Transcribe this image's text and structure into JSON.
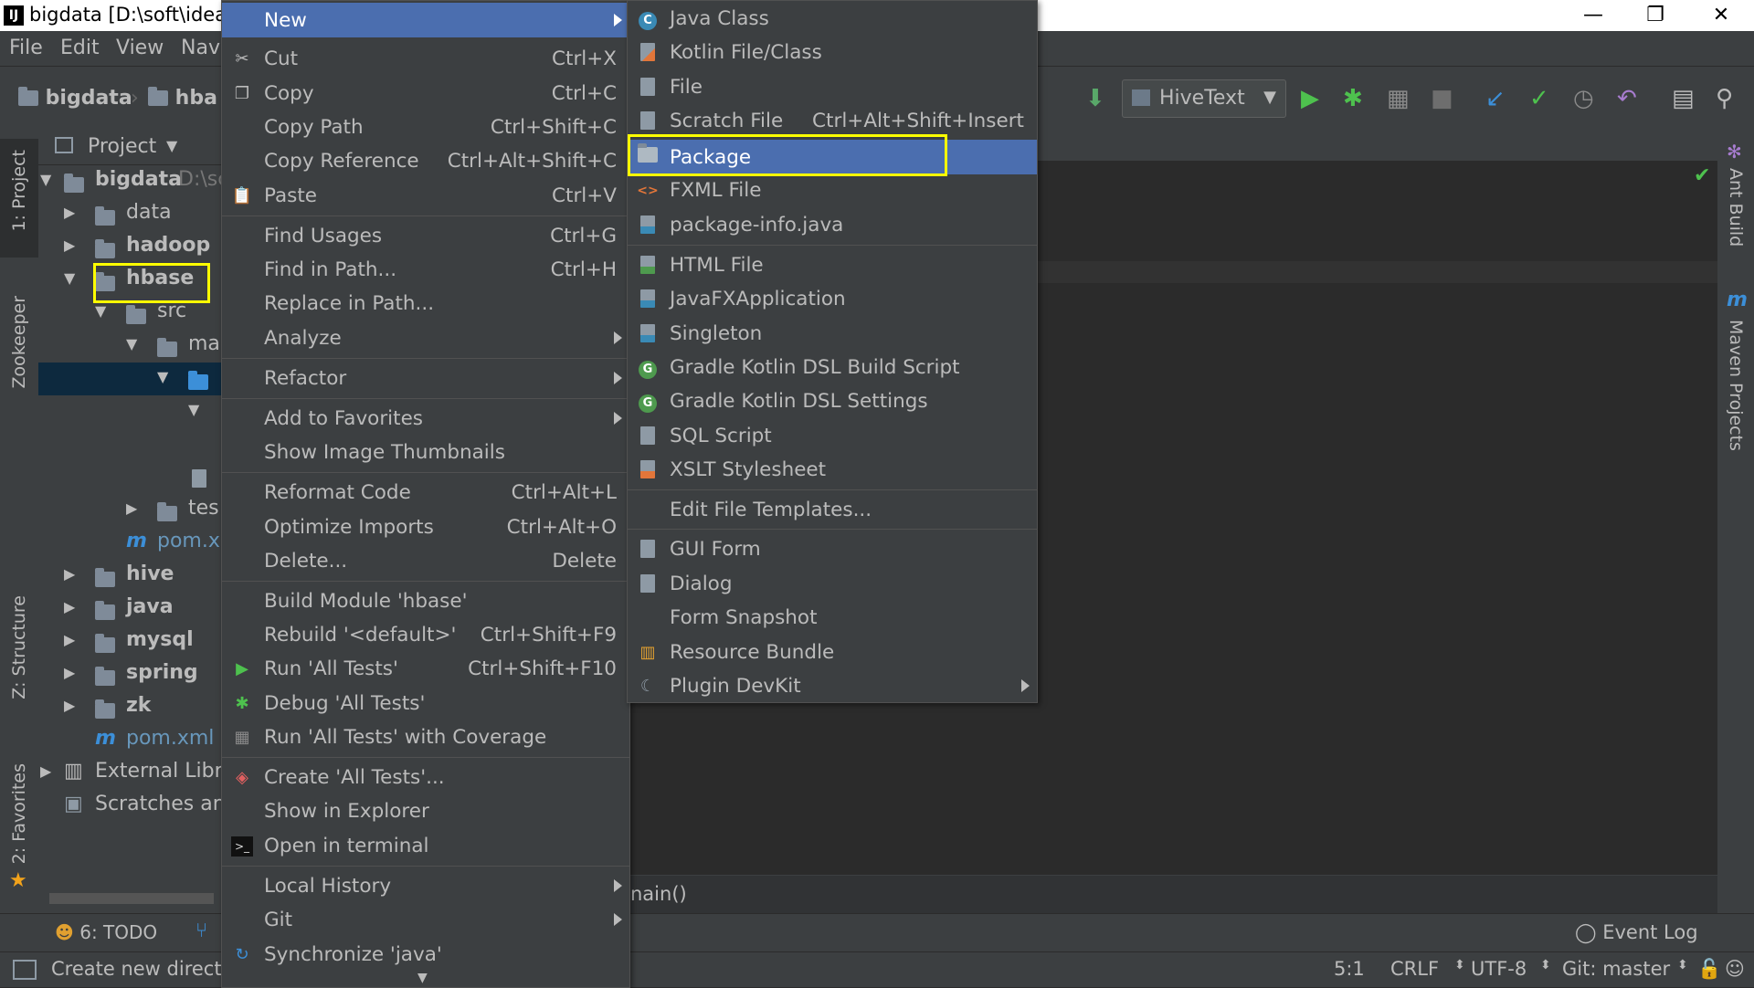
{
  "window": {
    "title": "bigdata [D:\\soft\\ideafiles",
    "ij_label": "IJ",
    "min_glyph": "—",
    "max_glyph": "❐",
    "close_glyph": "✕"
  },
  "menubar": [
    {
      "label": "File"
    },
    {
      "label": "Edit"
    },
    {
      "label": "View"
    },
    {
      "label": "Nav"
    }
  ],
  "breadcrumb": [
    {
      "label": "bigdata"
    },
    {
      "label": "hba"
    }
  ],
  "toolbar": {
    "run_config": "HiveText"
  },
  "left_stripe": {
    "project": "1: Project",
    "zookeeper": "Zookeeper",
    "structure": "Z: Structure",
    "favorites": "2: Favorites"
  },
  "project_panel": {
    "header": "Project",
    "tree": [
      {
        "label": "bigdata",
        "suffix": "D:\\sc",
        "bold": true,
        "expanded": true
      },
      {
        "label": "data"
      },
      {
        "label": "hadoop",
        "bold": true
      },
      {
        "label": "hbase",
        "bold": true,
        "expanded": true
      },
      {
        "label": "src",
        "expanded": true
      },
      {
        "label": "ma",
        "expanded": true
      },
      {
        "label": ""
      },
      {
        "label": ""
      },
      {
        "label": ""
      },
      {
        "label": "tes"
      },
      {
        "label": "pom.xı"
      },
      {
        "label": "hive",
        "bold": true
      },
      {
        "label": "java",
        "bold": true
      },
      {
        "label": "mysql",
        "bold": true
      },
      {
        "label": "spring",
        "bold": true
      },
      {
        "label": "zk",
        "bold": true
      },
      {
        "label": "pom.xml"
      },
      {
        "label": "External Libra"
      },
      {
        "label": "Scratches and"
      }
    ]
  },
  "editor": {
    "breadcrumb_text": "nain()"
  },
  "right_stripe": {
    "ant": "Ant Build",
    "maven": "Maven Projects"
  },
  "bottom_tools": {
    "todo": "6: TODO",
    "event_log": "Event Log"
  },
  "statusbar": {
    "message": "Create new directo",
    "position": "5:1",
    "line_sep": "CRLF",
    "encoding": "UTF-8",
    "vcs": "Git: master"
  },
  "context_menu": {
    "items": [
      {
        "label": "New",
        "submenu": true,
        "selected": true
      },
      {
        "label": "Cut",
        "shortcut": "Ctrl+X",
        "icon": "scissors-icon"
      },
      {
        "label": "Copy",
        "shortcut": "Ctrl+C",
        "icon": "copy-icon"
      },
      {
        "label": "Copy Path",
        "shortcut": "Ctrl+Shift+C"
      },
      {
        "label": "Copy Reference",
        "shortcut": "Ctrl+Alt+Shift+C"
      },
      {
        "label": "Paste",
        "shortcut": "Ctrl+V",
        "icon": "paste-icon"
      },
      {
        "label": "Find Usages",
        "shortcut": "Ctrl+G"
      },
      {
        "label": "Find in Path...",
        "shortcut": "Ctrl+H"
      },
      {
        "label": "Replace in Path..."
      },
      {
        "label": "Analyze",
        "submenu": true
      },
      {
        "label": "Refactor",
        "submenu": true
      },
      {
        "label": "Add to Favorites",
        "submenu": true
      },
      {
        "label": "Show Image Thumbnails"
      },
      {
        "label": "Reformat Code",
        "shortcut": "Ctrl+Alt+L"
      },
      {
        "label": "Optimize Imports",
        "shortcut": "Ctrl+Alt+O"
      },
      {
        "label": "Delete...",
        "shortcut": "Delete"
      },
      {
        "label": "Build Module 'hbase'"
      },
      {
        "label": "Rebuild '<default>'",
        "shortcut": "Ctrl+Shift+F9"
      },
      {
        "label": "Run 'All Tests'",
        "shortcut": "Ctrl+Shift+F10",
        "icon": "run-icon"
      },
      {
        "label": "Debug 'All Tests'",
        "icon": "debug-icon"
      },
      {
        "label": "Run 'All Tests' with Coverage",
        "icon": "coverage-icon"
      },
      {
        "label": "Create 'All Tests'...",
        "icon": "create-test-icon"
      },
      {
        "label": "Show in Explorer"
      },
      {
        "label": "Open in terminal",
        "icon": "terminal-icon"
      },
      {
        "label": "Local History",
        "submenu": true
      },
      {
        "label": "Git",
        "submenu": true
      },
      {
        "label": "Synchronize 'java'",
        "icon": "sync-icon"
      }
    ]
  },
  "new_submenu": {
    "items": [
      {
        "label": "Java Class",
        "icon": "java-class-icon",
        "icon_text": "C"
      },
      {
        "label": "Kotlin File/Class",
        "icon": "kotlin-file-icon"
      },
      {
        "label": "File",
        "icon": "file-icon"
      },
      {
        "label": "Scratch File",
        "shortcut": "Ctrl+Alt+Shift+Insert",
        "icon": "scratch-file-icon"
      },
      {
        "label": "Package",
        "icon": "package-icon",
        "selected": true
      },
      {
        "label": "FXML File",
        "icon": "fxml-file-icon"
      },
      {
        "label": "package-info.java",
        "icon": "package-info-icon"
      },
      {
        "label": "HTML File",
        "icon": "html-file-icon"
      },
      {
        "label": "JavaFXApplication",
        "icon": "javafx-icon"
      },
      {
        "label": "Singleton",
        "icon": "singleton-icon"
      },
      {
        "label": "Gradle Kotlin DSL Build Script",
        "icon": "gradle-icon",
        "icon_text": "G"
      },
      {
        "label": "Gradle Kotlin DSL Settings",
        "icon": "gradle-icon",
        "icon_text": "G"
      },
      {
        "label": "SQL Script",
        "icon": "sql-icon"
      },
      {
        "label": "XSLT Stylesheet",
        "icon": "xslt-icon"
      },
      {
        "label": "Edit File Templates..."
      },
      {
        "label": "GUI Form",
        "icon": "gui-form-icon"
      },
      {
        "label": "Dialog",
        "icon": "dialog-icon"
      },
      {
        "label": "Form Snapshot"
      },
      {
        "label": "Resource Bundle",
        "icon": "resource-bundle-icon"
      },
      {
        "label": "Plugin DevKit",
        "icon": "plugin-icon",
        "submenu": true
      }
    ]
  },
  "colors": {
    "menu_bg": "#3c3f41",
    "selection": "#4b6eaf",
    "highlight_box": "#ffff00"
  }
}
